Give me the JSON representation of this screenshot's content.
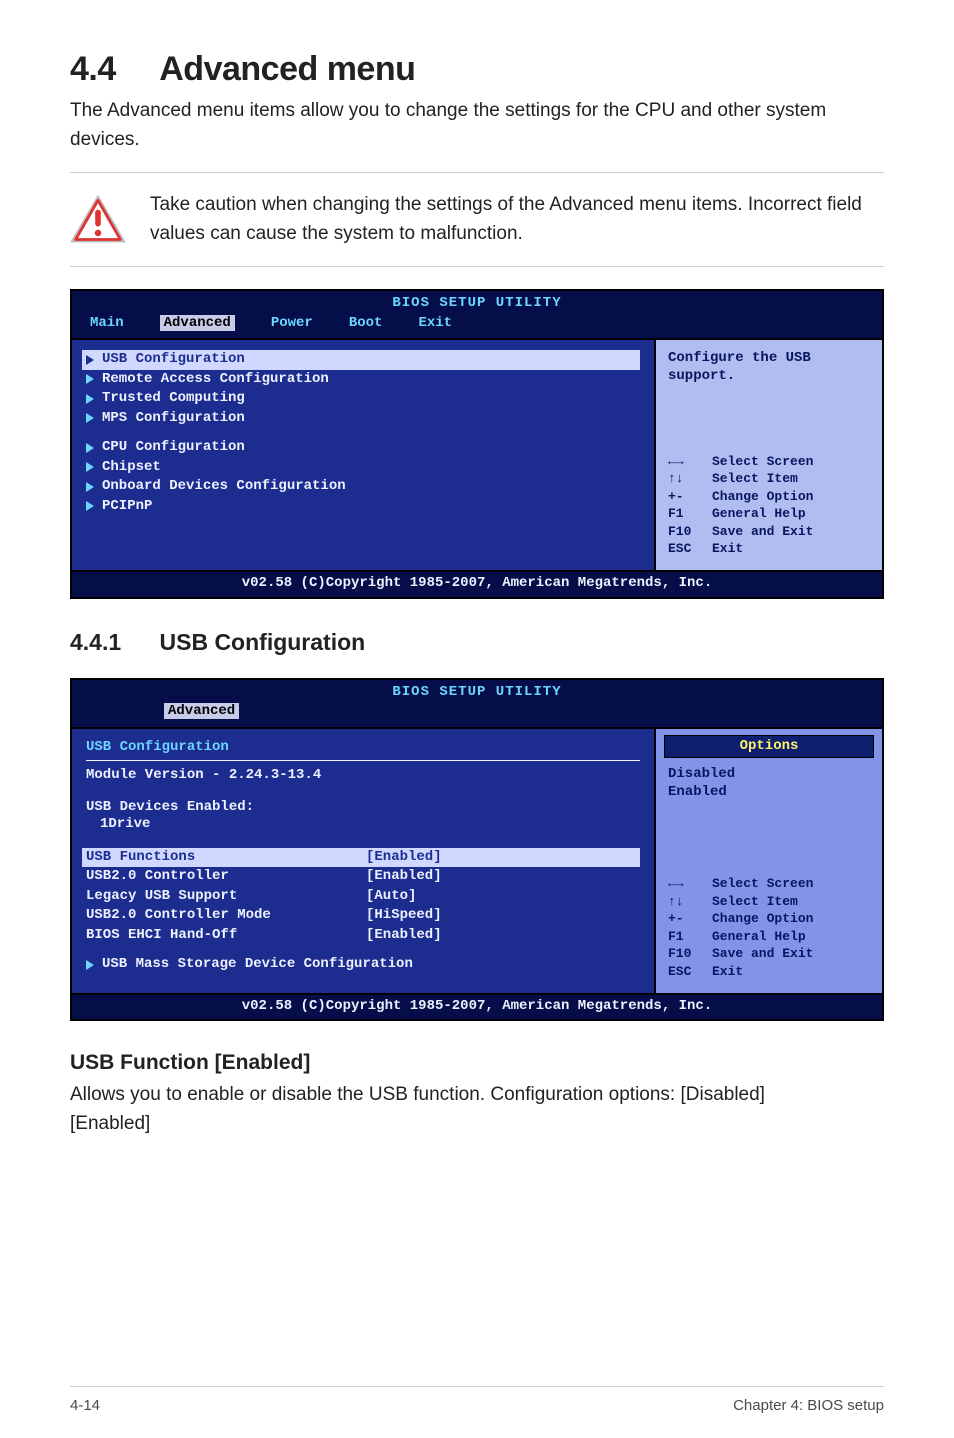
{
  "section": {
    "number": "4.4",
    "title": "Advanced menu",
    "intro": "The Advanced menu items allow you to change the settings for the CPU and other system devices."
  },
  "warning": {
    "text": "Take caution when changing the settings of the Advanced menu items. Incorrect field values can cause the system to malfunction."
  },
  "bios1": {
    "title": "BIOS SETUP UTILITY",
    "tabs": [
      "Main",
      "Advanced",
      "Power",
      "Boot",
      "Exit"
    ],
    "selectedTab": "Advanced",
    "help": [
      "Configure the USB",
      "support."
    ],
    "groups": [
      [
        "USB Configuration",
        "Remote Access Configuration",
        "Trusted Computing",
        "MPS Configuration"
      ],
      [
        "CPU Configuration",
        "Chipset",
        "Onboard Devices Configuration",
        "PCIPnP"
      ]
    ],
    "selectedItem": "USB Configuration",
    "keys": [
      {
        "k": "←→",
        "v": "Select Screen"
      },
      {
        "k": "↑↓",
        "v": "Select Item"
      },
      {
        "k": "+-",
        "v": "Change Option"
      },
      {
        "k": "F1",
        "v": "General Help"
      },
      {
        "k": "F10",
        "v": "Save and Exit"
      },
      {
        "k": "ESC",
        "v": "Exit"
      }
    ],
    "footer": "v02.58 (C)Copyright 1985-2007, American Megatrends, Inc."
  },
  "subsection": {
    "number": "4.4.1",
    "title": "USB Configuration"
  },
  "bios2": {
    "title": "BIOS SETUP UTILITY",
    "tab": "Advanced",
    "heading": "USB Configuration",
    "moduleLine": "Module Version - 2.24.3-13.4",
    "devicesLabel": "USB Devices Enabled:",
    "devicesValue": "1Drive",
    "rows": [
      {
        "k": "USB Functions",
        "v": "[Enabled]",
        "sel": true
      },
      {
        "k": "USB2.0 Controller",
        "v": "[Enabled]"
      },
      {
        "k": "Legacy USB Support",
        "v": "[Auto]"
      },
      {
        "k": "USB2.0 Controller Mode",
        "v": "[HiSpeed]"
      },
      {
        "k": "BIOS EHCI Hand-Off",
        "v": "[Enabled]"
      }
    ],
    "submenu": "USB Mass Storage Device Configuration",
    "optionsTitle": "Options",
    "options": [
      "Disabled",
      "Enabled"
    ],
    "keys": [
      {
        "k": "←→",
        "v": "Select Screen"
      },
      {
        "k": "↑↓",
        "v": "Select Item"
      },
      {
        "k": "+-",
        "v": "Change Option"
      },
      {
        "k": "F1",
        "v": "General Help"
      },
      {
        "k": "F10",
        "v": "Save and Exit"
      },
      {
        "k": "ESC",
        "v": "Exit"
      }
    ],
    "footer": "v02.58 (C)Copyright 1985-2007, American Megatrends, Inc."
  },
  "usbFunc": {
    "heading": "USB Function [Enabled]",
    "line1": "Allows you to enable or disable the USB function. Configuration options: [Disabled]",
    "line2": "[Enabled]"
  },
  "footer": {
    "left": "4-14",
    "right": "Chapter 4: BIOS setup"
  }
}
